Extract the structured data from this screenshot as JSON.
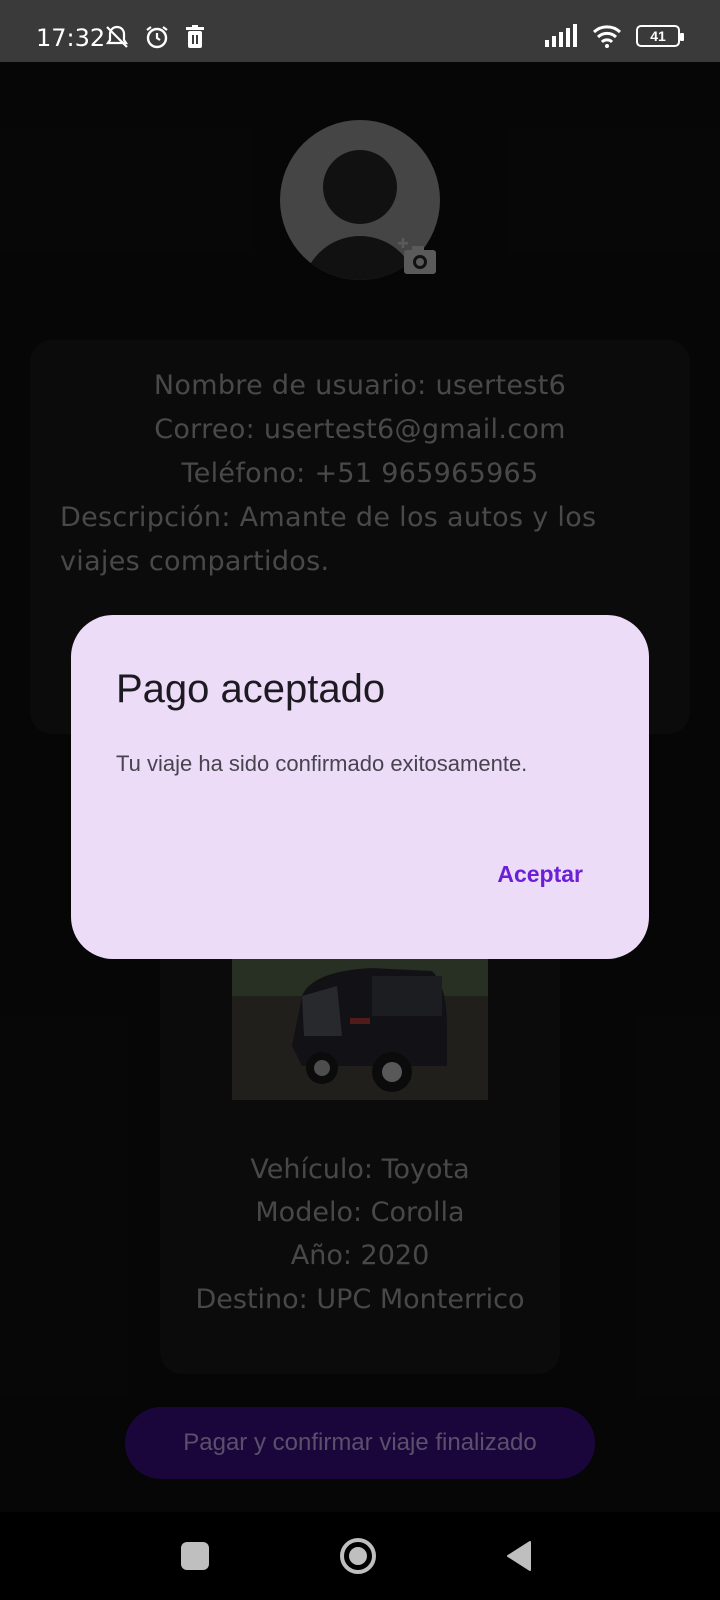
{
  "status_bar": {
    "time": "17:32",
    "battery": "41",
    "icons_left": [
      "mute-icon",
      "alarm-icon",
      "trash-icon"
    ],
    "icons_right": [
      "signal-icon",
      "wifi-icon",
      "battery-icon"
    ]
  },
  "profile": {
    "username_line": "Nombre de usuario: usertest6",
    "email_line": "Correo: usertest6@gmail.com",
    "phone_line": "Teléfono: +51 965965965",
    "description_line": "Descripción: Amante de los autos y los viajes compartidos."
  },
  "car": {
    "vehicle_line": "Vehículo: Toyota",
    "model_line": "Modelo: Corolla",
    "year_line": "Año: 2020",
    "destination_line": "Destino: UPC Monterrico"
  },
  "pay_button_label": "Pagar y confirmar viaje finalizado",
  "dialog": {
    "title": "Pago aceptado",
    "message": "Tu viaje ha sido confirmado exitosamente.",
    "accept_label": "Aceptar"
  },
  "colors": {
    "dialog_bg": "#ecdcf8",
    "accent": "#6b1fd6",
    "pay_button_bg": "#2a0a5c"
  }
}
